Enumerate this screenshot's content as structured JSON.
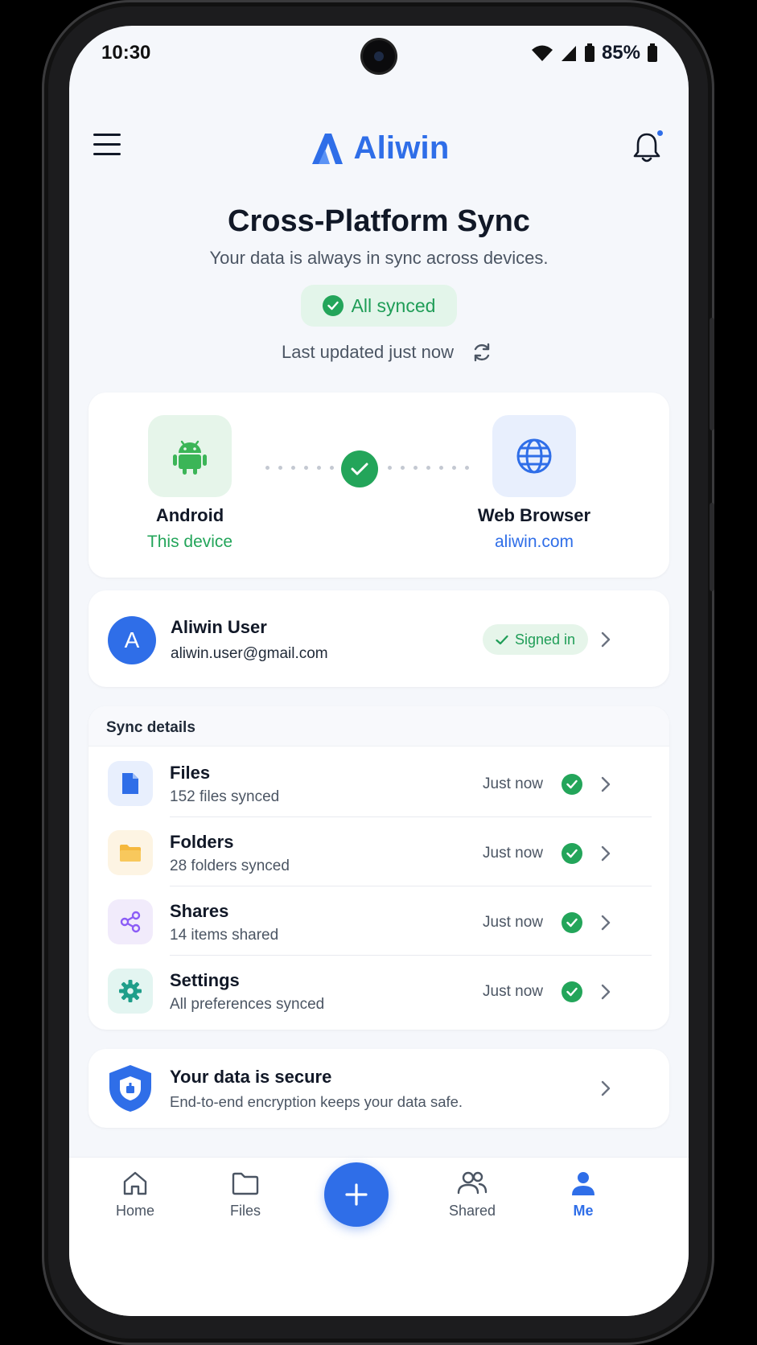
{
  "status_bar": {
    "time": "10:30",
    "battery": "85%"
  },
  "header": {
    "brand": "Aliwin"
  },
  "hero": {
    "title": "Cross-Platform Sync",
    "subtitle": "Your data is always in sync across devices.",
    "status_pill": "All synced",
    "last_updated": "Last updated just now"
  },
  "devices": {
    "left": {
      "name": "Android",
      "sub": "This device"
    },
    "right": {
      "name": "Web Browser",
      "sub": "aliwin.com"
    }
  },
  "account": {
    "initial": "A",
    "name": "Aliwin User",
    "email": "aliwin.user@gmail.com",
    "status": "Signed in"
  },
  "sync_details": {
    "heading": "Sync details",
    "rows": [
      {
        "title": "Files",
        "sub": "152 files synced",
        "when": "Just now"
      },
      {
        "title": "Folders",
        "sub": "28 folders synced",
        "when": "Just now"
      },
      {
        "title": "Shares",
        "sub": "14 items shared",
        "when": "Just now"
      },
      {
        "title": "Settings",
        "sub": "All preferences synced",
        "when": "Just now"
      }
    ]
  },
  "secure": {
    "title": "Your data is secure",
    "sub": "End-to-end encryption keeps your data safe."
  },
  "nav": {
    "items": [
      {
        "label": "Home",
        "icon": "home-icon"
      },
      {
        "label": "Files",
        "icon": "folder-icon"
      },
      {
        "label": "Shared",
        "icon": "people-icon"
      },
      {
        "label": "Me",
        "icon": "person-icon"
      }
    ],
    "active": "Me"
  },
  "colors": {
    "brand": "#2f6ee8",
    "success": "#23a55a",
    "background": "#f5f7fb"
  }
}
